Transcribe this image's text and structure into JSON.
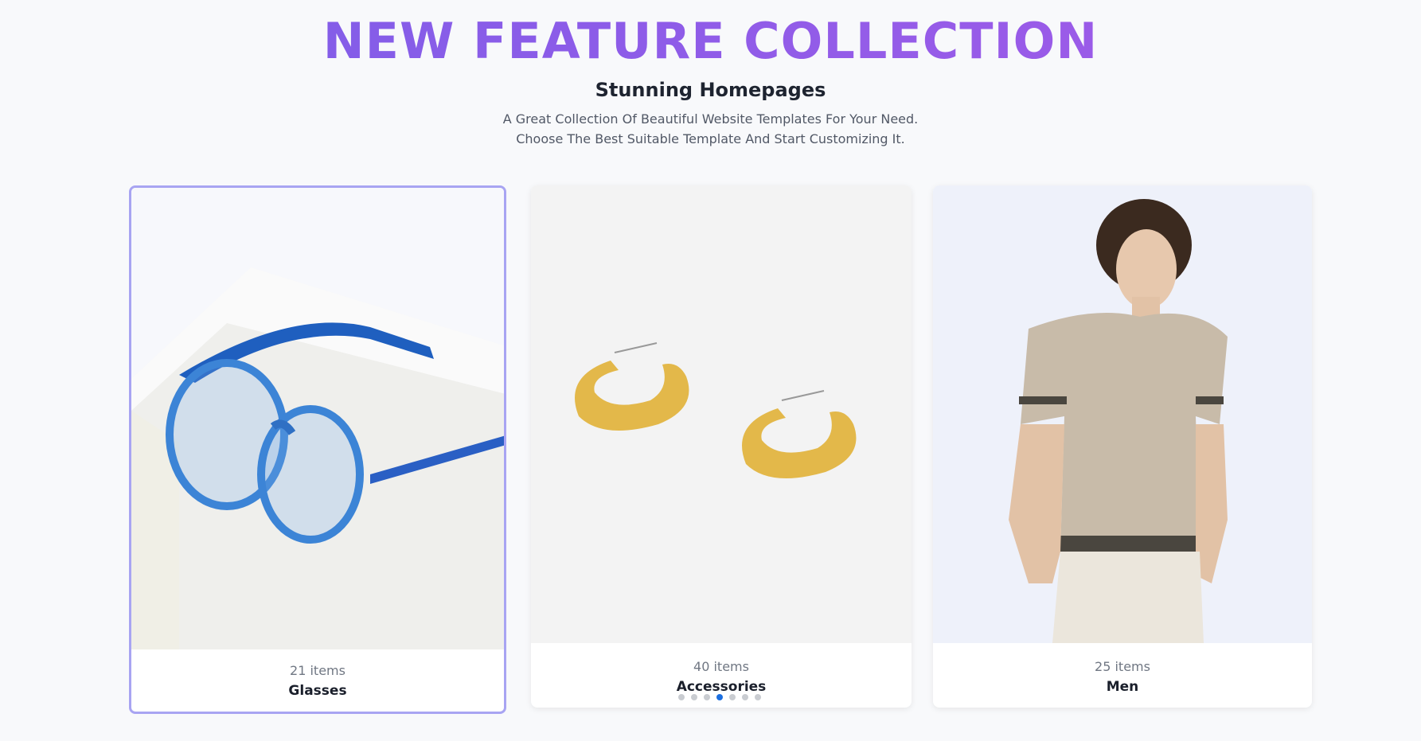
{
  "header": {
    "title": "NEW FEATURE COLLECTION",
    "subtitle": "Stunning Homepages",
    "description": "A Great Collection Of Beautiful Website Templates For Your Need. Choose The Best Suitable Template And Start Customizing It."
  },
  "colors": {
    "title_gradient_start": "#7b5ee8",
    "title_gradient_end": "#a45ae8",
    "active_border": "#a8a4f2",
    "dot_active": "#1c6fe0",
    "dot_inactive": "#c9ccd1"
  },
  "cards": [
    {
      "count": "21 items",
      "name": "Glasses",
      "image": "blue-eyeglasses-image"
    },
    {
      "count": "40 items",
      "name": "Accessories",
      "image": "gold-hoop-earrings-image"
    },
    {
      "count": "25 items",
      "name": "Men",
      "image": "man-polo-shirt-image"
    }
  ],
  "carousel": {
    "total": 7,
    "active_index": 3
  }
}
